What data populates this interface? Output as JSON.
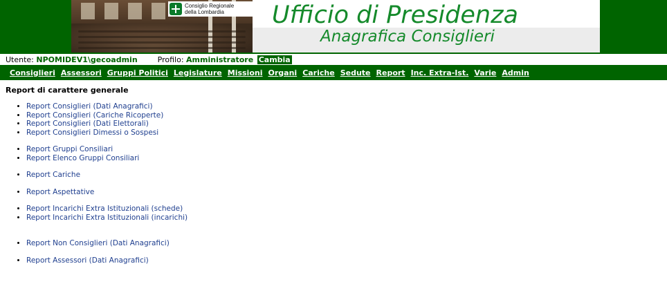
{
  "header": {
    "logo_line1": "Consiglio Regionale",
    "logo_line2": "della Lombardia",
    "title": "Ufficio di Presidenza",
    "subtitle": "Anagrafica Consiglieri"
  },
  "userbar": {
    "user_label": "Utente:",
    "user_value": "NPOMIDEV1\\gecoadmin",
    "profile_label": "Profilo:",
    "profile_value": "Amministratore",
    "change_button": "Cambia"
  },
  "menu": {
    "items": [
      {
        "label": "Consiglieri"
      },
      {
        "label": "Assessori"
      },
      {
        "label": "Gruppi Politici"
      },
      {
        "label": "Legislature"
      },
      {
        "label": "Missioni"
      },
      {
        "label": "Organi"
      },
      {
        "label": "Cariche"
      },
      {
        "label": "Sedute"
      },
      {
        "label": "Report"
      },
      {
        "label": "Inc. Extra-Ist."
      },
      {
        "label": "Varie"
      },
      {
        "label": "Admin"
      }
    ]
  },
  "main": {
    "section_title": "Report di carattere generale",
    "links": [
      "Report Consiglieri (Dati Anagrafici)",
      "Report Consiglieri (Cariche Ricoperte)",
      "Report Consiglieri (Dati Elettorali)",
      "Report Consiglieri Dimessi o Sospesi",
      "Report Gruppi Consiliari",
      "Report Elenco Gruppi Consiliari",
      "Report Cariche",
      "Report Aspettative",
      "Report Incarichi Extra Istituzionali (schede)",
      "Report Incarichi Extra Istituzionali (incarichi)",
      "Report Non Consiglieri (Dati Anagrafici)",
      "Report Assessori (Dati Anagrafici)"
    ]
  },
  "colors": {
    "brand_green": "#006400",
    "title_green": "#158a2b",
    "link_blue": "#1f3f8f"
  }
}
